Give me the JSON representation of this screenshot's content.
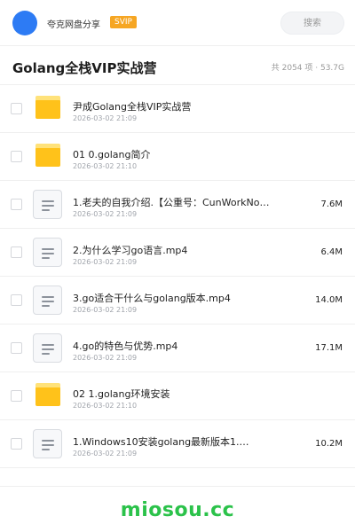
{
  "topbar": {
    "brand": "夸克网盘分享",
    "badge": "SVIP",
    "search_label": "搜索"
  },
  "header": {
    "title": "Golang全栈VIP实战营",
    "summary": "共 2054 项 · 53.7G"
  },
  "items": [
    {
      "type": "folder",
      "name": "尹成Golang全栈VIP实战营",
      "date": "2026-03-02 21:09",
      "size": ""
    },
    {
      "type": "folder",
      "name": "01 0.golang简介",
      "date": "2026-03-02 21:10",
      "size": ""
    },
    {
      "type": "file",
      "name": "1.老夫的自我介绍.【公重号：CunWorkNot…",
      "date": "2026-03-02 21:09",
      "size": "7.6M"
    },
    {
      "type": "file",
      "name": "2.为什么学习go语言.mp4",
      "date": "2026-03-02 21:09",
      "size": "6.4M"
    },
    {
      "type": "file",
      "name": "3.go适合干什么与golang版本.mp4",
      "date": "2026-03-02 21:09",
      "size": "14.0M"
    },
    {
      "type": "file",
      "name": "4.go的特色与优势.mp4",
      "date": "2026-03-02 21:09",
      "size": "17.1M"
    },
    {
      "type": "folder",
      "name": "02 1.golang环境安装",
      "date": "2026-03-02 21:10",
      "size": ""
    },
    {
      "type": "file",
      "name": "1.Windows10安装golang最新版本1.…",
      "date": "2026-03-02 21:09",
      "size": "10.2M"
    }
  ],
  "footer": {
    "watermark": "miosou.cc"
  },
  "colors": {
    "avatar": "#2d7bf4",
    "badge": "#f6a623",
    "folder": "#ffc21a",
    "watermark": "#2bc24a"
  }
}
